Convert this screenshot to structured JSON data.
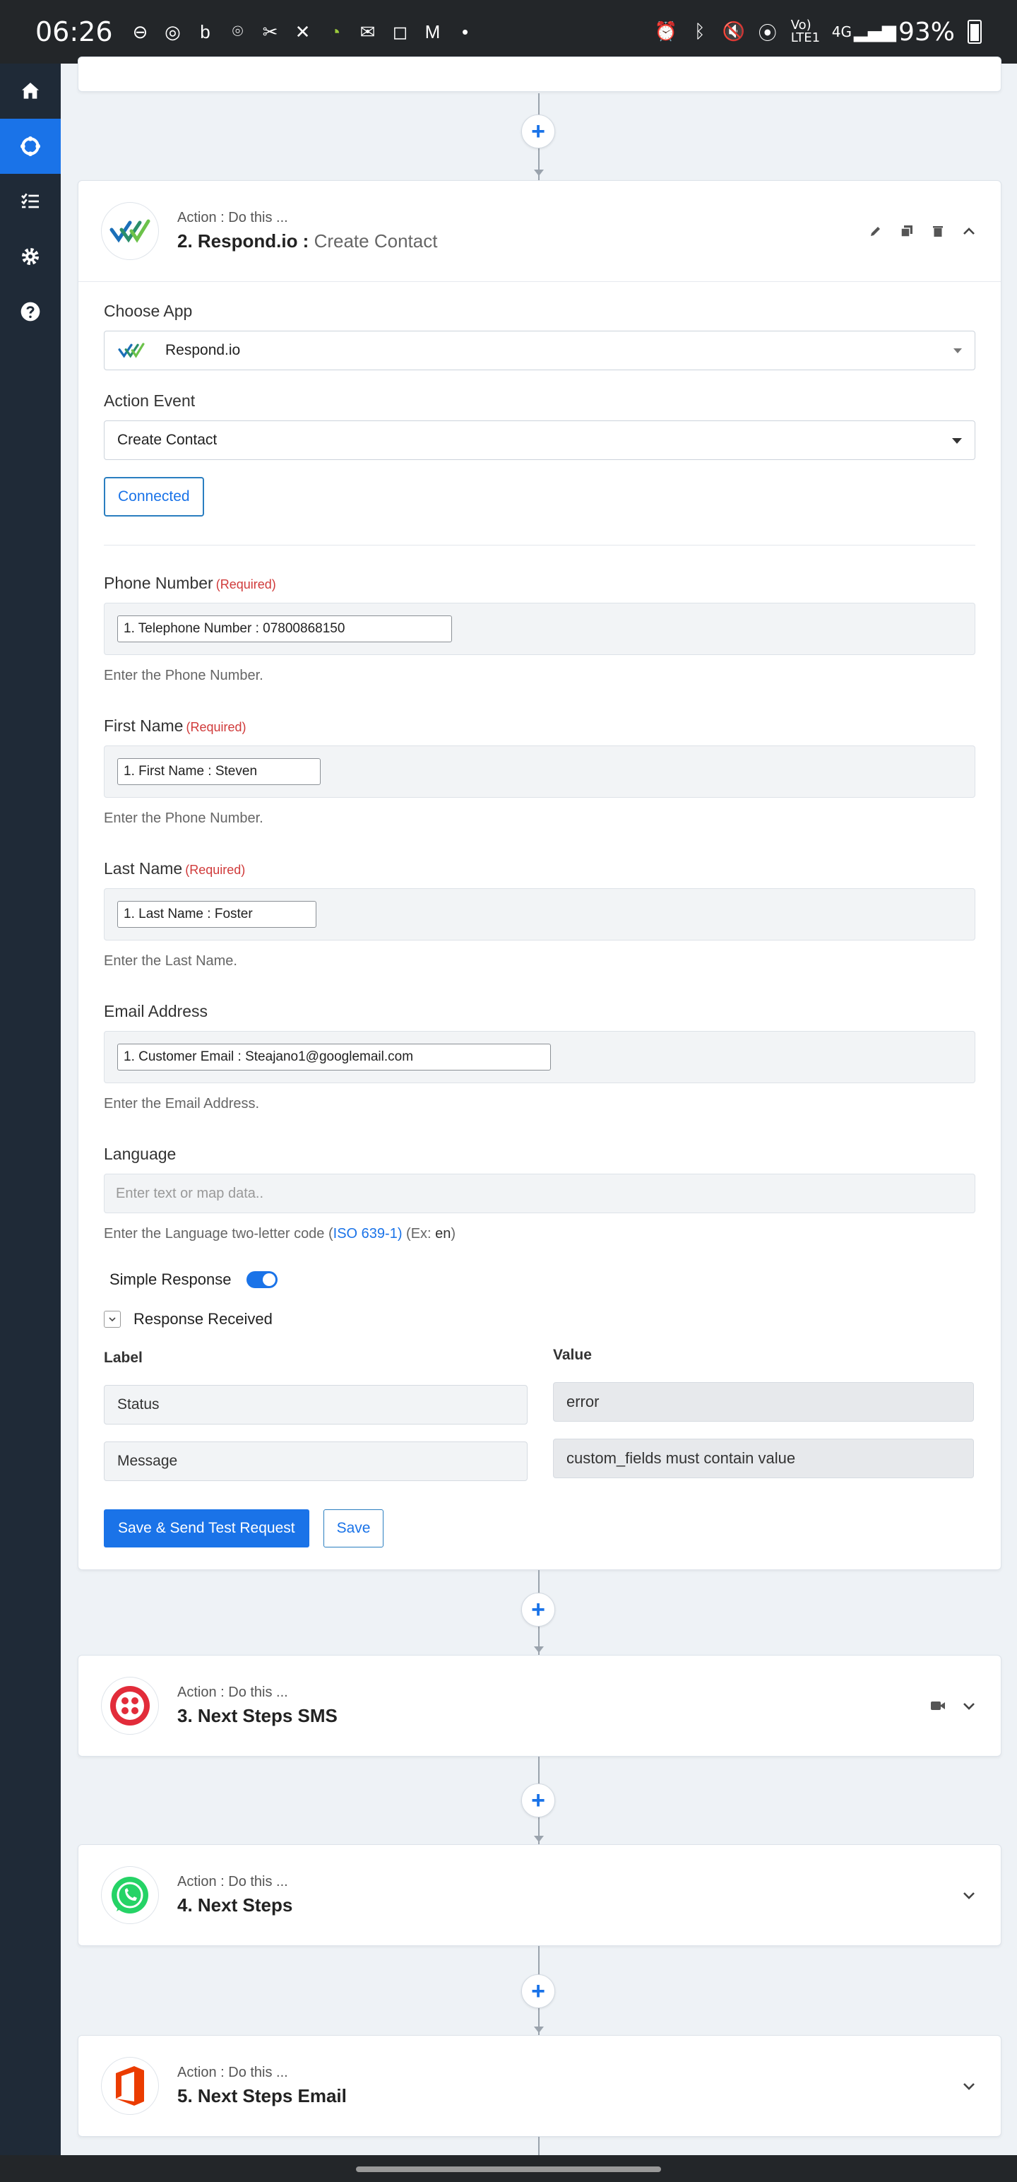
{
  "status_bar": {
    "time": "06:26",
    "network": "Vo) LTE1",
    "signal": "4G",
    "battery": "93%"
  },
  "sidebar": {
    "items": [
      {
        "name": "home-icon"
      },
      {
        "name": "workflow-icon",
        "active": true
      },
      {
        "name": "tasks-icon"
      },
      {
        "name": "settings-icon"
      },
      {
        "name": "help-icon"
      }
    ]
  },
  "step2": {
    "subtitle": "Action : Do this ...",
    "title": "2. Respond.io :",
    "event": "Create Contact",
    "choose_app_label": "Choose App",
    "app_value": "Respond.io",
    "action_event_label": "Action Event",
    "action_event_value": "Create Contact",
    "connected_label": "Connected",
    "required_text": "(Required)",
    "fields": {
      "phone": {
        "label": "Phone Number",
        "chip": "1. Telephone Number : 07800868150",
        "help": "Enter the Phone Number."
      },
      "first": {
        "label": "First Name",
        "chip": "1. First Name : Steven",
        "help": "Enter the Phone Number."
      },
      "last": {
        "label": "Last Name",
        "chip": "1. Last Name : Foster",
        "help": "Enter the Last Name."
      },
      "email": {
        "label": "Email Address",
        "chip": "1. Customer Email : Steajano1@googlemail.com",
        "help": "Enter the Email Address."
      },
      "language": {
        "label": "Language",
        "placeholder": "Enter text or map data..",
        "help_prefix": "Enter the Language two-letter code (",
        "help_link": "ISO 639-1)",
        "help_mid": " (Ex: ",
        "help_example": "en",
        "help_suffix": ")"
      }
    },
    "simple_response_label": "Simple Response",
    "response_received_label": "Response Received",
    "response": {
      "label_header": "Label",
      "value_header": "Value",
      "rows": [
        {
          "label": "Status",
          "value": "error"
        },
        {
          "label": "Message",
          "value": "custom_fields must contain value"
        }
      ]
    },
    "save_test_label": "Save & Send Test Request",
    "save_label": "Save"
  },
  "step3": {
    "subtitle": "Action : Do this ...",
    "title": "3. Next Steps SMS"
  },
  "step4": {
    "subtitle": "Action : Do this ...",
    "title": "4. Next Steps"
  },
  "step5": {
    "subtitle": "Action : Do this ...",
    "title": "5. Next Steps Email"
  },
  "add_step_symbol": "+",
  "colors": {
    "accent": "#1a73e8",
    "sidebar": "#1f2a37",
    "required": "#d03a3a",
    "twilio": "#e22c3a",
    "whatsapp": "#25d366",
    "office": "#eb3c00"
  }
}
